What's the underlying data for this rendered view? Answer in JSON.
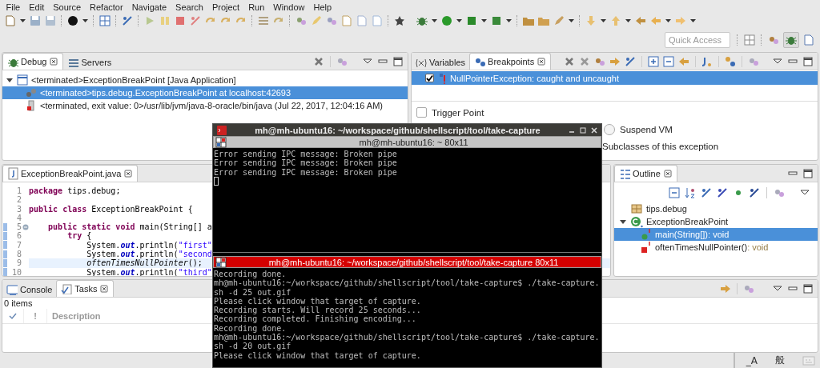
{
  "menu": [
    "File",
    "Edit",
    "Source",
    "Refactor",
    "Navigate",
    "Search",
    "Project",
    "Run",
    "Window",
    "Help"
  ],
  "quick_access": {
    "placeholder": "Quick Access"
  },
  "debug_panel": {
    "tabs": [
      {
        "label": "Debug",
        "selected": true
      },
      {
        "label": "Servers",
        "selected": false
      }
    ],
    "tree": [
      {
        "label": "<terminated>ExceptionBreakPoint [Java Application]",
        "expanded": true,
        "selected": false,
        "children": [
          {
            "label": "<terminated>tips.debug.ExceptionBreakPoint at localhost:42693",
            "selected": true
          },
          {
            "label": "<terminated, exit value: 0>/usr/lib/jvm/java-8-oracle/bin/java (Jul 22, 2017, 12:04:16 AM)",
            "selected": false
          }
        ]
      }
    ]
  },
  "breakpoints_panel": {
    "tabs": [
      {
        "label": "Variables",
        "selected": false
      },
      {
        "label": "Breakpoints",
        "selected": true
      }
    ],
    "breakpoints": [
      {
        "label": "NullPointerException: caught and uncaught",
        "checked": true,
        "selected": true
      }
    ],
    "options": [
      {
        "kind": "checkbox",
        "label": "Trigger Point",
        "checked": false
      },
      {
        "kind": "radio",
        "label": "Suspend VM",
        "selected": false
      },
      {
        "kind": "text",
        "label": "Subclasses of this exception"
      }
    ]
  },
  "editor": {
    "tabs": [
      {
        "label": "ExceptionBreakPoint.java",
        "selected": true
      }
    ],
    "lines": [
      {
        "number": "1",
        "current": false,
        "range_marker": false,
        "foldable": false,
        "tokens": [
          {
            "kind": "keyword",
            "text": "package"
          },
          {
            "kind": "plain",
            "text": " tips.debug;"
          }
        ]
      },
      {
        "number": "2",
        "current": false,
        "range_marker": false,
        "foldable": false
      },
      {
        "number": "3",
        "current": false,
        "range_marker": false,
        "foldable": false,
        "tokens": [
          {
            "kind": "keyword",
            "text": "public class"
          },
          {
            "kind": "plain",
            "text": " ExceptionBreakPoint {"
          }
        ]
      },
      {
        "number": "4",
        "current": false,
        "range_marker": false,
        "foldable": false
      },
      {
        "number": "5",
        "current": false,
        "range_marker": true,
        "foldable": true,
        "tokens": [
          {
            "kind": "keyword",
            "text": "    public static void"
          },
          {
            "kind": "plain",
            "text": " main(String[] a"
          }
        ]
      },
      {
        "number": "6",
        "current": false,
        "range_marker": true,
        "foldable": false,
        "tokens": [
          {
            "kind": "keyword",
            "text": "        try"
          },
          {
            "kind": "plain",
            "text": " {"
          }
        ]
      },
      {
        "number": "7",
        "current": false,
        "range_marker": true,
        "foldable": false,
        "tokens": [
          {
            "kind": "plain",
            "text": "            System."
          },
          {
            "kind": "field",
            "text": "out"
          },
          {
            "kind": "plain",
            "text": ".println("
          },
          {
            "kind": "string",
            "text": "\"first\""
          }
        ]
      },
      {
        "number": "8",
        "current": false,
        "range_marker": true,
        "foldable": false,
        "tokens": [
          {
            "kind": "plain",
            "text": "            System."
          },
          {
            "kind": "field",
            "text": "out"
          },
          {
            "kind": "plain",
            "text": ".println("
          },
          {
            "kind": "string",
            "text": "\"second"
          }
        ]
      },
      {
        "number": "9",
        "current": true,
        "range_marker": true,
        "foldable": false,
        "tokens": [
          {
            "kind": "method",
            "text": "            oftenTimesNullPointer"
          },
          {
            "kind": "plain",
            "text": "();"
          }
        ]
      },
      {
        "number": "10",
        "current": false,
        "range_marker": true,
        "foldable": false,
        "tokens": [
          {
            "kind": "plain",
            "text": "            System."
          },
          {
            "kind": "field",
            "text": "out"
          },
          {
            "kind": "plain",
            "text": ".println("
          },
          {
            "kind": "string",
            "text": "\"third\""
          }
        ]
      }
    ]
  },
  "outline": {
    "tabs": [
      {
        "label": "Outline",
        "selected": true
      }
    ],
    "tree": [
      {
        "kind": "package",
        "label": "tips.debug",
        "selected": false
      },
      {
        "kind": "class",
        "label": "ExceptionBreakPoint",
        "expanded": true,
        "selected": false,
        "children": [
          {
            "kind": "public_method",
            "label": "main(String[])",
            "type": " : void",
            "selected": true
          },
          {
            "kind": "private_method",
            "label": "oftenTimesNullPointer()",
            "type": " : void",
            "selected": false
          }
        ]
      }
    ]
  },
  "tasks_panel": {
    "tabs": [
      {
        "label": "Console",
        "selected": false
      },
      {
        "label": "Tasks",
        "selected": true
      }
    ],
    "count": "0 items",
    "columns": [
      "!",
      "Description"
    ]
  },
  "terminal": {
    "title": "mh@mh-ubuntu16: ~/workspace/github/shellscript/tool/take-capture",
    "panes": [
      {
        "header": "mh@mh-ubuntu16: ~ 80x11",
        "active": false,
        "cursor": true,
        "lines": [
          "Error sending IPC message: Broken pipe",
          "Error sending IPC message: Broken pipe",
          "Error sending IPC message: Broken pipe"
        ]
      },
      {
        "header": "mh@mh-ubuntu16: ~/workspace/github/shellscript/tool/take-capture 80x11",
        "active": true,
        "cursor": false,
        "lines": [
          "Recording done.",
          "mh@mh-ubuntu16:~/workspace/github/shellscript/tool/take-capture$ ./take-capture.",
          "sh -d 25 out.gif",
          "Please click window that target of capture.",
          "Recording starts. Will record 25 seconds...",
          "Recording completed. Finishing encoding...",
          "Recording done.",
          "mh@mh-ubuntu16:~/workspace/github/shellscript/tool/take-capture$ ./take-capture.",
          "sh -d 20 out.gif",
          "Please click window that target of capture."
        ]
      }
    ]
  },
  "status_bar": {
    "items": [
      "_A",
      "般"
    ]
  }
}
